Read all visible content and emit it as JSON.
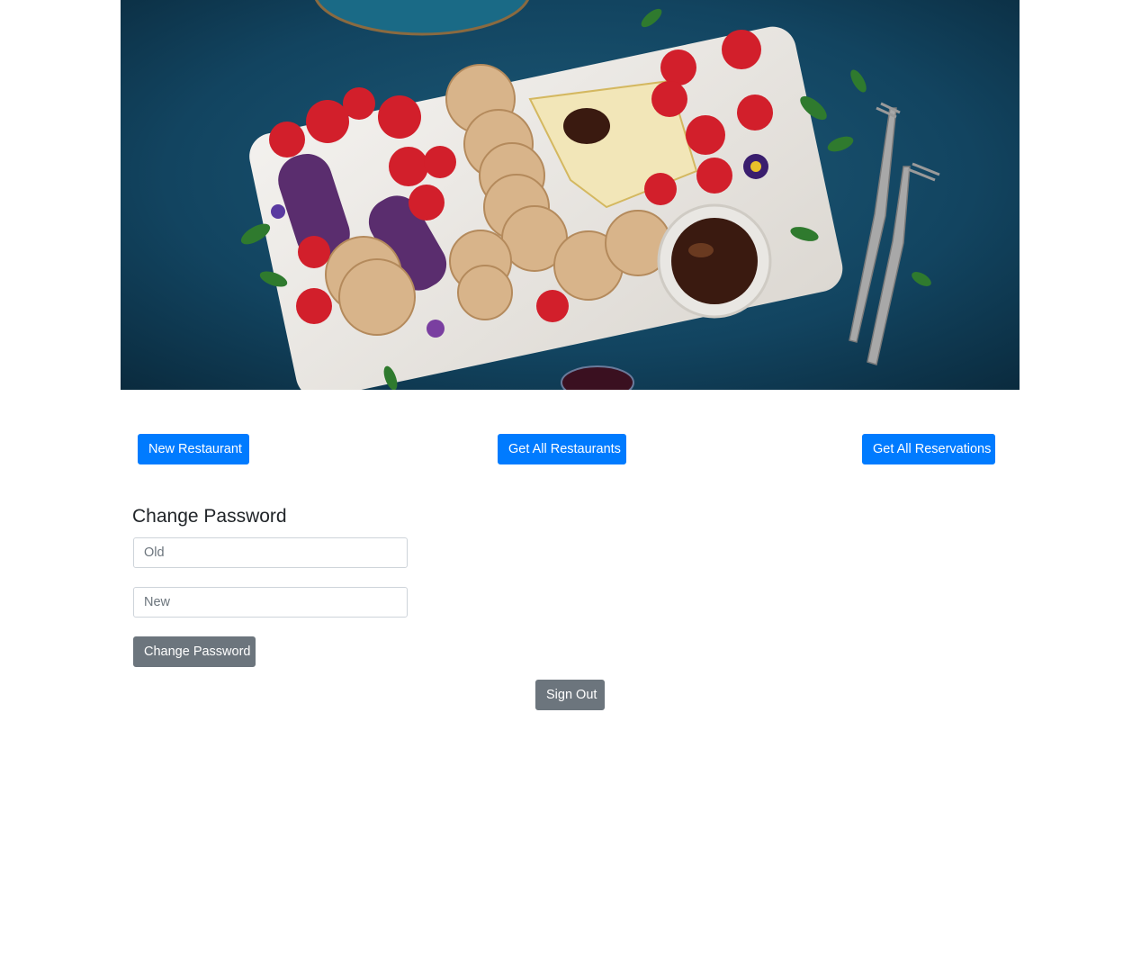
{
  "actions": {
    "new_restaurant": "New Restaurant",
    "get_all_restaurants": "Get All Restaurants",
    "get_all_reservations": "Get All Reservations"
  },
  "change_password": {
    "heading": "Change Password",
    "old_placeholder": "Old",
    "new_placeholder": "New",
    "submit_label": "Change Password"
  },
  "sign_out_label": "Sign Out",
  "colors": {
    "primary": "#007bff",
    "secondary": "#6c757d",
    "hero_background": "#123f57"
  }
}
